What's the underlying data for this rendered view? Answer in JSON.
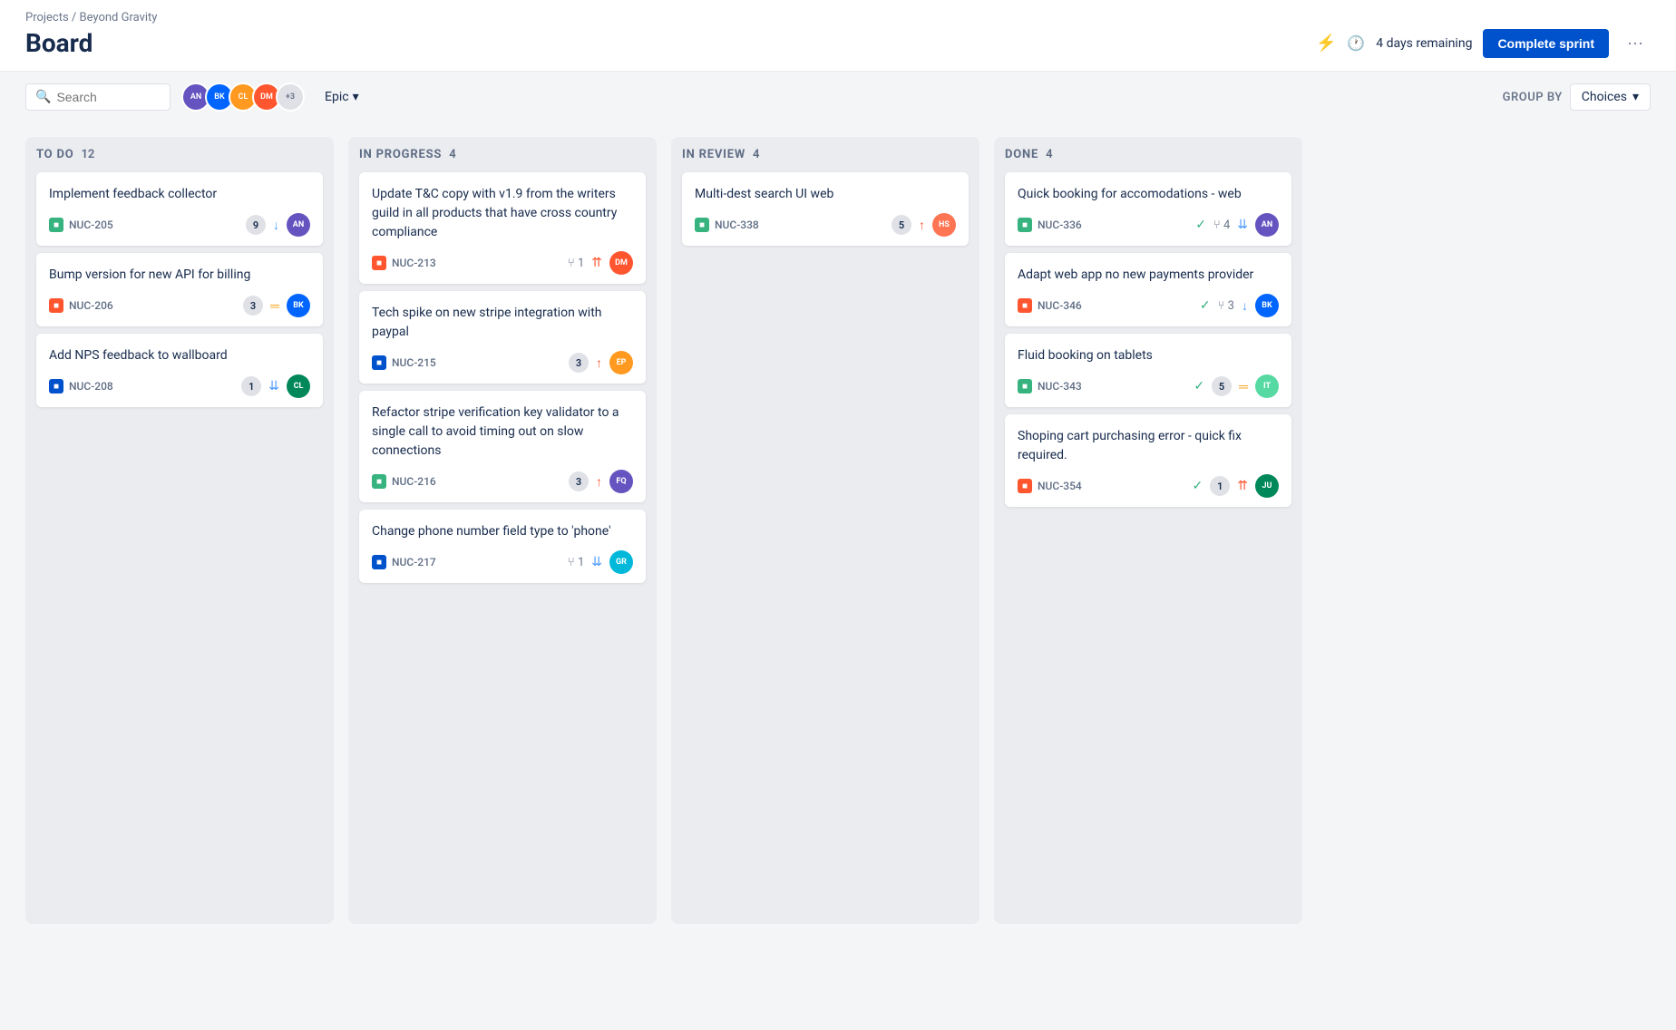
{
  "breadcrumb": "Projects / Beyond Gravity",
  "page_title": "Board",
  "header": {
    "sprint_remaining": "4 days remaining",
    "complete_sprint_btn": "Complete sprint",
    "more_btn": "···"
  },
  "toolbar": {
    "search_placeholder": "Search",
    "group_by_label": "GROUP BY",
    "choices_label": "Choices",
    "epic_label": "Epic"
  },
  "columns": [
    {
      "id": "todo",
      "title": "TO DO",
      "count": 12,
      "cards": [
        {
          "id": "c1",
          "title": "Implement feedback collector",
          "issue_id": "NUC-205",
          "issue_type": "story",
          "badge": "9",
          "priority": "down",
          "priority_class": "low",
          "has_avatar": true,
          "avatar_color": "av1",
          "avatar_initials": "AN"
        },
        {
          "id": "c2",
          "title": "Bump version for new API for billing",
          "issue_id": "NUC-206",
          "issue_type": "bug",
          "badge": "3",
          "priority": "medium",
          "priority_class": "medium",
          "has_avatar": true,
          "avatar_color": "av2",
          "avatar_initials": "BK"
        },
        {
          "id": "c3",
          "title": "Add NPS feedback to wallboard",
          "issue_id": "NUC-208",
          "issue_type": "task",
          "badge": "1",
          "priority": "lowest",
          "priority_class": "lowest",
          "has_avatar": true,
          "avatar_color": "av3",
          "avatar_initials": "CL"
        }
      ]
    },
    {
      "id": "inprogress",
      "title": "IN PROGRESS",
      "count": 4,
      "cards": [
        {
          "id": "c4",
          "title": "Update T&C copy with v1.9 from the writers guild in all products that have cross country compliance",
          "issue_id": "NUC-213",
          "issue_type": "bug",
          "has_branch": true,
          "branch_count": "1",
          "priority": "highest",
          "priority_class": "highest",
          "has_avatar": true,
          "avatar_color": "av4",
          "avatar_initials": "DM"
        },
        {
          "id": "c5",
          "title": "Tech spike on new stripe integration with paypal",
          "issue_id": "NUC-215",
          "issue_type": "task",
          "badge": "3",
          "priority": "high",
          "priority_class": "high",
          "has_avatar": true,
          "avatar_color": "av5",
          "avatar_initials": "EP"
        },
        {
          "id": "c6",
          "title": "Refactor stripe verification key validator to a single call to avoid timing out on slow connections",
          "issue_id": "NUC-216",
          "issue_type": "story",
          "badge": "3",
          "priority": "high",
          "priority_class": "high",
          "has_avatar": true,
          "avatar_color": "av6",
          "avatar_initials": "FQ"
        },
        {
          "id": "c7",
          "title": "Change phone number field type to 'phone'",
          "issue_id": "NUC-217",
          "issue_type": "task",
          "has_branch": true,
          "branch_count": "1",
          "priority": "lowest",
          "priority_class": "lowest",
          "has_avatar": true,
          "avatar_color": "av7",
          "avatar_initials": "GR"
        }
      ]
    },
    {
      "id": "inreview",
      "title": "IN REVIEW",
      "count": 4,
      "cards": [
        {
          "id": "c8",
          "title": "Multi-dest search UI web",
          "issue_id": "NUC-338",
          "issue_type": "story",
          "badge": "5",
          "priority": "high",
          "priority_class": "high",
          "has_avatar": true,
          "avatar_color": "av8",
          "avatar_initials": "HS"
        }
      ]
    },
    {
      "id": "done",
      "title": "DONE",
      "count": 4,
      "cards": [
        {
          "id": "c9",
          "title": "Quick booking for accomodations - web",
          "issue_id": "NUC-336",
          "issue_type": "story",
          "has_check": true,
          "has_branch": true,
          "branch_count": "4",
          "priority": "lowest",
          "priority_class": "lowest",
          "has_avatar": true,
          "avatar_color": "av1",
          "avatar_initials": "AN"
        },
        {
          "id": "c10",
          "title": "Adapt web app no new payments provider",
          "issue_id": "NUC-346",
          "issue_type": "bug",
          "has_check": true,
          "has_branch": true,
          "branch_count": "3",
          "priority": "down",
          "priority_class": "low",
          "has_avatar": true,
          "avatar_color": "av2",
          "avatar_initials": "BK"
        },
        {
          "id": "c11",
          "title": "Fluid booking on tablets",
          "issue_id": "NUC-343",
          "issue_type": "story",
          "has_check": true,
          "badge": "5",
          "priority": "medium",
          "priority_class": "medium",
          "has_avatar": true,
          "avatar_color": "av9",
          "avatar_initials": "IT"
        },
        {
          "id": "c12",
          "title": "Shoping cart purchasing error - quick fix required.",
          "issue_id": "NUC-354",
          "issue_type": "bug",
          "has_check": true,
          "badge": "1",
          "priority": "highest",
          "priority_class": "highest",
          "has_avatar": true,
          "avatar_color": "av3",
          "avatar_initials": "JU"
        }
      ]
    }
  ]
}
